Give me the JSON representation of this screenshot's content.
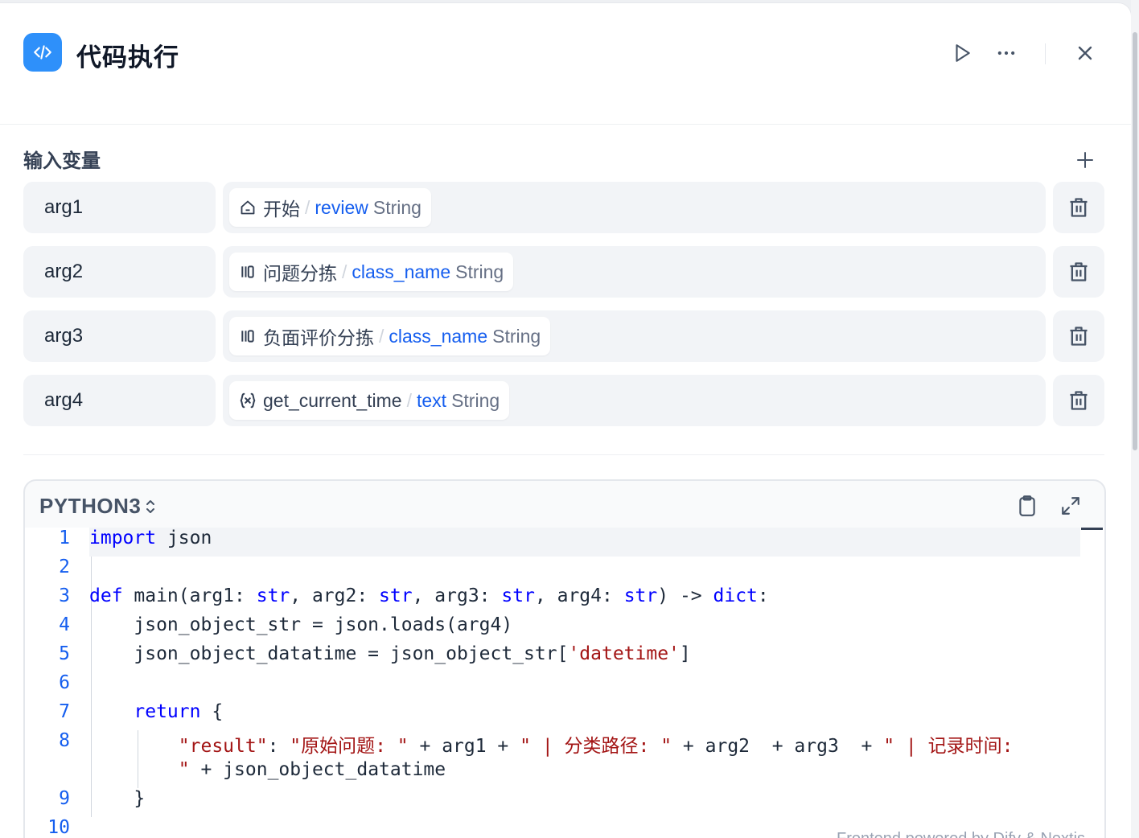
{
  "header": {
    "title": "代码执行",
    "icons": {
      "app": "code-icon",
      "run": "play-icon",
      "more": "more-icon",
      "close": "close-icon"
    }
  },
  "inputs": {
    "title": "输入变量",
    "rows": [
      {
        "name": "arg1",
        "node_icon": "home-icon",
        "node": "开始",
        "field": "review",
        "type": "String"
      },
      {
        "name": "arg2",
        "node_icon": "classifier-icon",
        "node": "问题分拣",
        "field": "class_name",
        "type": "String"
      },
      {
        "name": "arg3",
        "node_icon": "classifier-icon",
        "node": "负面评价分拣",
        "field": "class_name",
        "type": "String"
      },
      {
        "name": "arg4",
        "node_icon": "variable-icon",
        "node": "get_current_time",
        "field": "text",
        "type": "String"
      }
    ]
  },
  "code": {
    "language": "PYTHON3",
    "line_numbers": [
      "1",
      "2",
      "3",
      "4",
      "5",
      "6",
      "7",
      "8",
      "",
      "9",
      "10"
    ],
    "tokens": {
      "import": "import",
      "json": " json",
      "def": "def",
      "main_sig": " main(arg1: ",
      "str": "str",
      "c1": ", arg2: ",
      "c2": ", arg3: ",
      "c3": ", arg4: ",
      "arrow": ") -> ",
      "dict": "dict",
      "colon": ":",
      "l4": "    json_object_str = json.loads(arg4)",
      "l5a": "    json_object_datatime = json_object_str[",
      "l5s": "'datetime'",
      "l5b": "]",
      "ret": "return",
      "brace_open": " {",
      "l8k": "\"result\"",
      "l8c": ": ",
      "l8s1": "\"原始问题: \"",
      "l8p1": " + arg1 + ",
      "l8s2": "\" | 分类路径: \"",
      "l8p2": " + arg2  + arg3  + ",
      "l8s3": "\" | 记录时间:",
      "l8w1": "\"",
      "l8w2": " + json_object_datatime",
      "brace_close": "}"
    }
  },
  "colors": {
    "accent": "#2e90fa",
    "keyword": "#0000ff",
    "string": "#a31515",
    "field": "#155eef"
  },
  "footer": "Frontend powered by Dify & Nextjs"
}
